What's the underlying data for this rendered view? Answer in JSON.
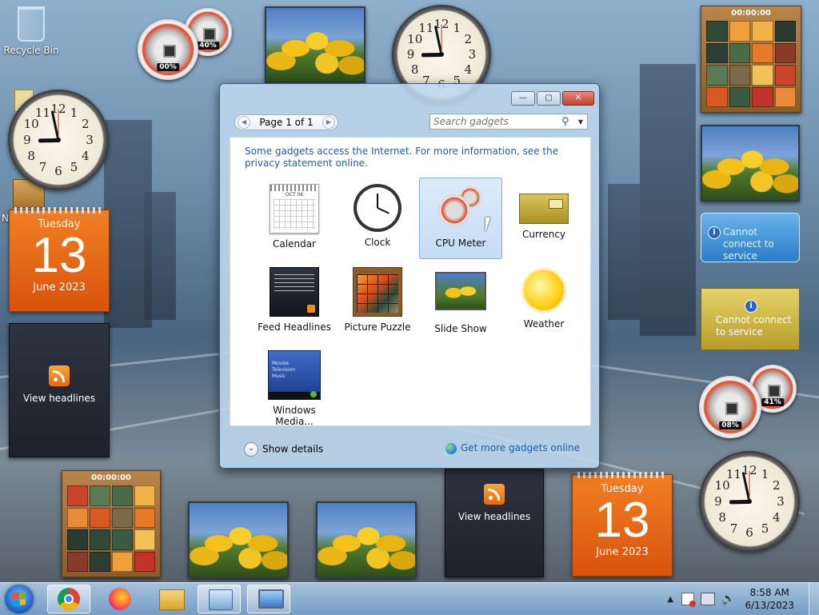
{
  "desktop": {
    "recycle_bin_label": "Recycle Bin",
    "partial_icon_label": "N"
  },
  "gadgets": {
    "calendar_left": {
      "weekday": "Tuesday",
      "day": "13",
      "month_year": "June 2023"
    },
    "calendar_right": {
      "weekday": "Tuesday",
      "day": "13",
      "month_year": "June 2023"
    },
    "cpu_top": {
      "cpu": "00%",
      "memory": "40%"
    },
    "cpu_right": {
      "cpu": "08%",
      "memory": "41%"
    },
    "puzzle_top": {
      "timer": "00:00:00"
    },
    "puzzle_bottom": {
      "timer": "00:00:00"
    },
    "feed_left": {
      "label": "View headlines"
    },
    "feed_bottom": {
      "label": "View headlines"
    },
    "currency_info": {
      "text": "Cannot connect to service"
    },
    "weather_info": {
      "text": "Cannot connect to service"
    },
    "clock_numbers": [
      "12",
      "1",
      "2",
      "3",
      "4",
      "5",
      "6",
      "7",
      "8",
      "9",
      "10",
      "11"
    ]
  },
  "gadget_window": {
    "page_label": "Page 1 of 1",
    "search_placeholder": "Search gadgets",
    "notice": "Some gadgets access the Internet.  For more information, see the privacy statement online.",
    "items": [
      {
        "label": "Calendar",
        "icon": "calendar-icon"
      },
      {
        "label": "Clock",
        "icon": "clock-icon"
      },
      {
        "label": "CPU Meter",
        "icon": "cpu-meter-icon",
        "selected": true
      },
      {
        "label": "Currency",
        "icon": "currency-icon"
      },
      {
        "label": "Feed Headlines",
        "icon": "feed-icon"
      },
      {
        "label": "Picture Puzzle",
        "icon": "puzzle-icon"
      },
      {
        "label": "Slide Show",
        "icon": "slideshow-icon"
      },
      {
        "label": "Weather",
        "icon": "weather-icon"
      },
      {
        "label": "Windows Media...",
        "icon": "media-center-icon"
      }
    ],
    "calendar_thumb_month": "OCT 06",
    "media_thumb_lines": [
      "Movies",
      "Television",
      "Music"
    ],
    "show_details": "Show details",
    "get_more": "Get more gadgets online"
  },
  "taskbar": {
    "apps": [
      "chrome-icon",
      "firefox-icon",
      "explorer-folder-icon",
      "gadgets-icon",
      "display-icon"
    ],
    "time": "8:58 AM",
    "date": "6/13/2023"
  },
  "colors": {
    "accent": "#1f5fa8",
    "calendar_orange": "#e8681a",
    "selection": "#c5dcf5"
  }
}
